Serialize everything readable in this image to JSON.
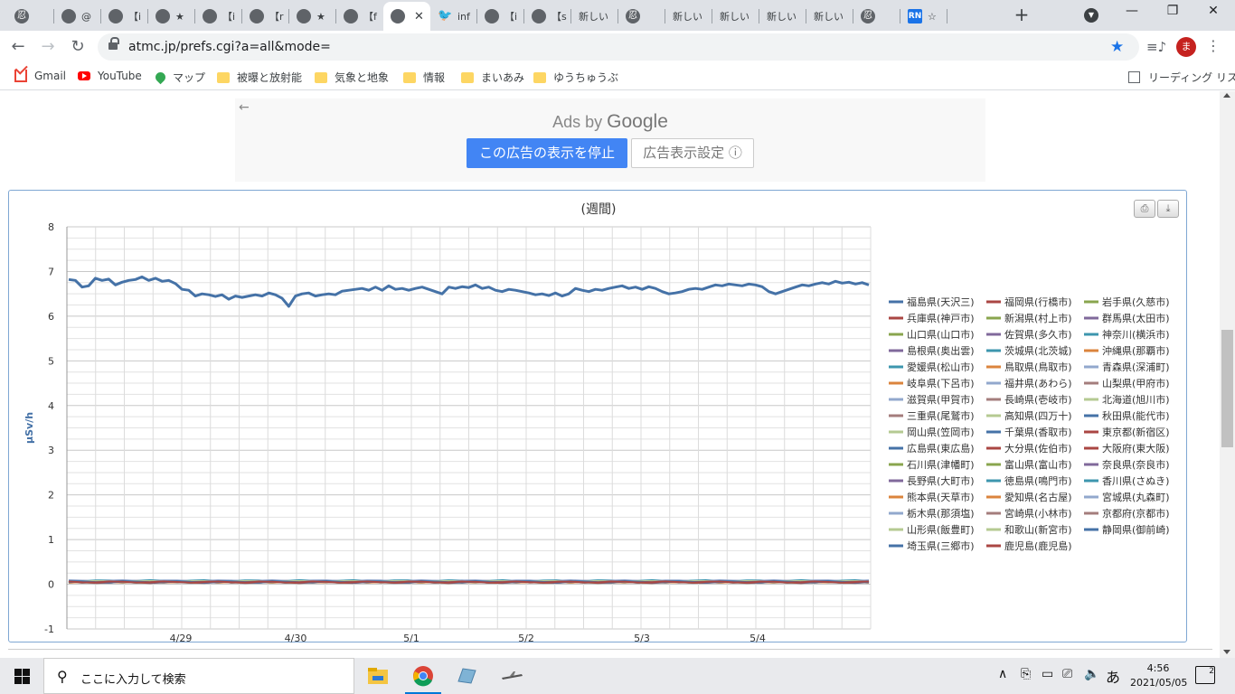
{
  "tabs": [
    {
      "fav": "忍",
      "title": "",
      "active": false
    },
    {
      "fav": "",
      "title": "@",
      "active": false
    },
    {
      "fav": "",
      "title": "【i",
      "active": false
    },
    {
      "fav": "",
      "title": "★",
      "active": false
    },
    {
      "fav": "",
      "title": "【i",
      "active": false
    },
    {
      "fav": "",
      "title": "【r",
      "active": false
    },
    {
      "fav": "",
      "title": "★",
      "active": false
    },
    {
      "fav": "",
      "title": "【f",
      "active": false
    },
    {
      "fav": "",
      "title": "",
      "active": true,
      "close": "✕"
    },
    {
      "fav": "twitter",
      "title": "inf",
      "active": false
    },
    {
      "fav": "",
      "title": "【i",
      "active": false
    },
    {
      "fav": "",
      "title": "【s",
      "active": false
    },
    {
      "fav": "none",
      "title": "新しい",
      "active": false
    },
    {
      "fav": "忍",
      "title": "",
      "active": false
    },
    {
      "fav": "none",
      "title": "新しい",
      "active": false
    },
    {
      "fav": "none",
      "title": "新しい",
      "active": false
    },
    {
      "fav": "none",
      "title": "新しい",
      "active": false
    },
    {
      "fav": "none",
      "title": "新しい",
      "active": false
    },
    {
      "fav": "忍",
      "title": "",
      "active": false
    },
    {
      "fav": "RN",
      "title": "☆",
      "active": false
    }
  ],
  "toolbar": {
    "url": "atmc.jp/prefs.cgi?a=all&mode=",
    "avatar": "ま"
  },
  "bookmarks": [
    {
      "icon": "gmail-icon",
      "label": "Gmail"
    },
    {
      "icon": "youtube-icon",
      "label": "YouTube"
    },
    {
      "icon": "maps-icon",
      "label": "マップ"
    },
    {
      "icon": "folder-icon",
      "label": "被曝と放射能"
    },
    {
      "icon": "folder-icon",
      "label": "気象と地象"
    },
    {
      "icon": "folder-icon",
      "label": "情報"
    },
    {
      "icon": "folder-icon",
      "label": "まいあみ"
    },
    {
      "icon": "folder-icon",
      "label": "ゆうちゅうぶ"
    }
  ],
  "reading_list": "リーディング リスト",
  "ad": {
    "ads_by": "Ads by",
    "google": "Google",
    "stop": "この広告の表示を停止",
    "settings": "広告表示設定 ⓘ"
  },
  "chart_data": {
    "type": "line",
    "title": "(週間)",
    "ylabel": "μSv/h",
    "ylim": [
      -1,
      8
    ],
    "yticks": [
      -1,
      0,
      1,
      2,
      3,
      4,
      5,
      6,
      7,
      8
    ],
    "xlabels": [
      "4/29",
      "4/30",
      "5/1",
      "5/2",
      "5/3",
      "5/4"
    ],
    "grid": true,
    "legend_position": "right",
    "legend_columns": 3,
    "series": [
      {
        "name": "福島県(天沢三)",
        "color": "#4572a7",
        "values": [
          6.82,
          6.8,
          6.65,
          6.68,
          6.85,
          6.8,
          6.83,
          6.7,
          6.76,
          6.8,
          6.82,
          6.88,
          6.8,
          6.85,
          6.78,
          6.8,
          6.73,
          6.6,
          6.58,
          6.45,
          6.5,
          6.48,
          6.44,
          6.48,
          6.38,
          6.45,
          6.42,
          6.45,
          6.48,
          6.45,
          6.52,
          6.48,
          6.4,
          6.22,
          6.45,
          6.5,
          6.52,
          6.45,
          6.48,
          6.5,
          6.48,
          6.56,
          6.58,
          6.6,
          6.62,
          6.58,
          6.65,
          6.58,
          6.68,
          6.6,
          6.62,
          6.58,
          6.62,
          6.65,
          6.6,
          6.55,
          6.5,
          6.65,
          6.62,
          6.66,
          6.64,
          6.7,
          6.62,
          6.65,
          6.58,
          6.55,
          6.6,
          6.58,
          6.55,
          6.52,
          6.48,
          6.5,
          6.46,
          6.52,
          6.45,
          6.5,
          6.62,
          6.58,
          6.55,
          6.6,
          6.58,
          6.62,
          6.65,
          6.68,
          6.62,
          6.65,
          6.6,
          6.66,
          6.62,
          6.55,
          6.5,
          6.52,
          6.55,
          6.6,
          6.62,
          6.6,
          6.65,
          6.7,
          6.68,
          6.72,
          6.7,
          6.68,
          6.72,
          6.7,
          6.66,
          6.55,
          6.5,
          6.55,
          6.6,
          6.65,
          6.7,
          6.68,
          6.72,
          6.75,
          6.72,
          6.78,
          6.74,
          6.76,
          6.72,
          6.75,
          6.7
        ]
      },
      {
        "name": "福岡県(行橋市)",
        "color": "#aa4643",
        "values": [
          0.05
        ]
      },
      {
        "name": "岩手県(久慈市)",
        "color": "#89a54e",
        "values": [
          0.05
        ]
      },
      {
        "name": "兵庫県(神戸市)",
        "color": "#aa4643",
        "values": [
          0.05
        ]
      },
      {
        "name": "新潟県(村上市)",
        "color": "#89a54e",
        "values": [
          0.07
        ]
      },
      {
        "name": "群馬県(太田市)",
        "color": "#80699b",
        "values": [
          0.05
        ]
      },
      {
        "name": "山口県(山口市)",
        "color": "#89a54e",
        "values": [
          0.05
        ]
      },
      {
        "name": "佐賀県(多久市)",
        "color": "#80699b",
        "values": [
          0.05
        ]
      },
      {
        "name": "神奈川(横浜市)",
        "color": "#3d96ae",
        "values": [
          0.05
        ]
      },
      {
        "name": "島根県(奥出雲)",
        "color": "#80699b",
        "values": [
          0.07
        ]
      },
      {
        "name": "茨城県(北茨城)",
        "color": "#3d96ae",
        "values": [
          0.08
        ]
      },
      {
        "name": "沖縄県(那覇市)",
        "color": "#db843d",
        "values": [
          0.05
        ]
      },
      {
        "name": "愛媛県(松山市)",
        "color": "#3d96ae",
        "values": [
          0.05
        ]
      },
      {
        "name": "鳥取県(鳥取市)",
        "color": "#db843d",
        "values": [
          0.07
        ]
      },
      {
        "name": "青森県(深浦町)",
        "color": "#92a8cd",
        "values": [
          0.04
        ]
      },
      {
        "name": "岐阜県(下呂市)",
        "color": "#db843d",
        "values": [
          0.06
        ]
      },
      {
        "name": "福井県(あわら)",
        "color": "#92a8cd",
        "values": [
          0.06
        ]
      },
      {
        "name": "山梨県(甲府市)",
        "color": "#a47d7c",
        "values": [
          0.05
        ]
      },
      {
        "name": "滋賀県(甲賀市)",
        "color": "#92a8cd",
        "values": [
          0.05
        ]
      },
      {
        "name": "長崎県(壱岐市)",
        "color": "#a47d7c",
        "values": [
          0.06
        ]
      },
      {
        "name": "北海道(旭川市)",
        "color": "#b5ca92",
        "values": [
          0.04
        ]
      },
      {
        "name": "三重県(尾鷲市)",
        "color": "#a47d7c",
        "values": [
          0.05
        ]
      },
      {
        "name": "高知県(四万十)",
        "color": "#b5ca92",
        "values": [
          0.05
        ]
      },
      {
        "name": "秋田県(能代市)",
        "color": "#4572a7",
        "values": [
          0.05
        ]
      },
      {
        "name": "岡山県(笠岡市)",
        "color": "#b5ca92",
        "values": [
          0.06
        ]
      },
      {
        "name": "千葉県(香取市)",
        "color": "#4572a7",
        "values": [
          0.05
        ]
      },
      {
        "name": "東京都(新宿区)",
        "color": "#aa4643",
        "values": [
          0.04
        ]
      },
      {
        "name": "広島県(東広島)",
        "color": "#4572a7",
        "values": [
          0.06
        ]
      },
      {
        "name": "大分県(佐伯市)",
        "color": "#aa4643",
        "values": [
          0.05
        ]
      },
      {
        "name": "大阪府(東大阪)",
        "color": "#aa4643",
        "values": [
          0.06
        ]
      },
      {
        "name": "石川県(津幡町)",
        "color": "#89a54e",
        "values": [
          0.06
        ]
      },
      {
        "name": "富山県(富山市)",
        "color": "#89a54e",
        "values": [
          0.06
        ]
      },
      {
        "name": "奈良県(奈良市)",
        "color": "#80699b",
        "values": [
          0.06
        ]
      },
      {
        "name": "長野県(大町市)",
        "color": "#80699b",
        "values": [
          0.05
        ]
      },
      {
        "name": "徳島県(鳴門市)",
        "color": "#3d96ae",
        "values": [
          0.05
        ]
      },
      {
        "name": "香川県(さぬき)",
        "color": "#3d96ae",
        "values": [
          0.06
        ]
      },
      {
        "name": "熊本県(天草市)",
        "color": "#db843d",
        "values": [
          0.05
        ]
      },
      {
        "name": "愛知県(名古屋)",
        "color": "#db843d",
        "values": [
          0.05
        ]
      },
      {
        "name": "宮城県(丸森町)",
        "color": "#92a8cd",
        "values": [
          0.07
        ]
      },
      {
        "name": "栃木県(那須塩)",
        "color": "#92a8cd",
        "values": [
          0.08
        ]
      },
      {
        "name": "宮崎県(小林市)",
        "color": "#a47d7c",
        "values": [
          0.05
        ]
      },
      {
        "name": "京都府(京都市)",
        "color": "#a47d7c",
        "values": [
          0.06
        ]
      },
      {
        "name": "山形県(飯豊町)",
        "color": "#b5ca92",
        "values": [
          0.06
        ]
      },
      {
        "name": "和歌山(新宮市)",
        "color": "#b5ca92",
        "values": [
          0.06
        ]
      },
      {
        "name": "静岡県(御前崎)",
        "color": "#4572a7",
        "values": [
          0.05
        ]
      },
      {
        "name": "埼玉県(三郷市)",
        "color": "#4572a7",
        "values": [
          0.06
        ]
      },
      {
        "name": "鹿児島(鹿児島)",
        "color": "#aa4643",
        "values": [
          0.05
        ]
      }
    ]
  },
  "taskbar": {
    "search_placeholder": "ここに入力して検索",
    "ime": "あ",
    "time": "4:56",
    "date": "2021/05/05",
    "notifications": "2"
  }
}
